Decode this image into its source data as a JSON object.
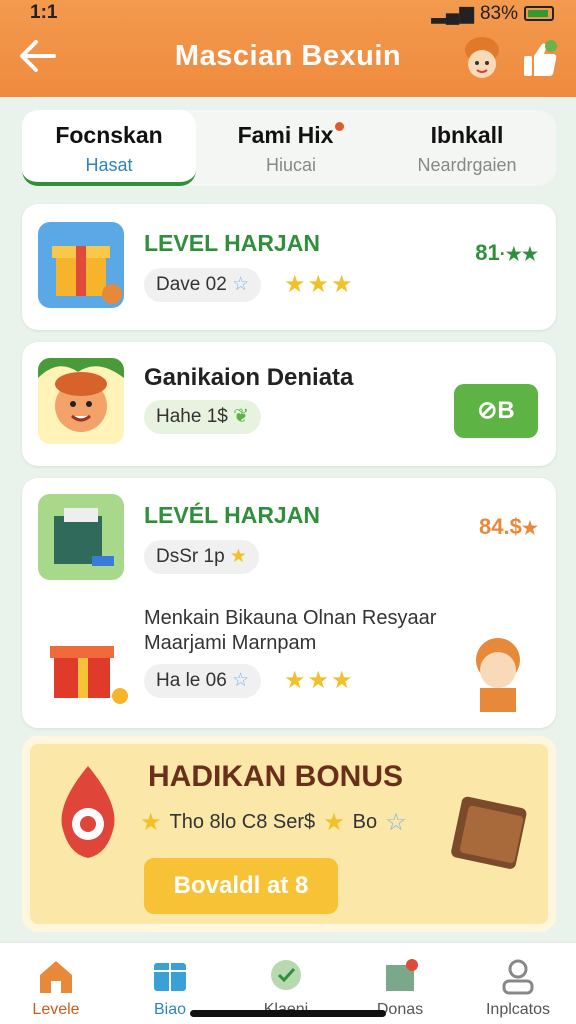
{
  "status_bar": {
    "time": "1:1",
    "battery": "83%"
  },
  "header": {
    "title": "Mascian Bexuin"
  },
  "tabs": [
    {
      "label": "Focnskan",
      "sub": "Hasat"
    },
    {
      "label": "Fami Hix",
      "sub": "Hiucai"
    },
    {
      "label": "Ibnkall",
      "sub": "Neardrgaien"
    }
  ],
  "cards": [
    {
      "title": "LEVEL HARJAN",
      "pill": "Dave 02",
      "score": "81",
      "score_color": "#2f8f3a"
    },
    {
      "title": "Ganikaion Deniata",
      "pill": "Hahe 1$",
      "badge": "B"
    },
    {
      "title": "LEVÉL HARJAN",
      "pill": "DsSr 1p",
      "score": "84.$",
      "score_color": "#e8893a",
      "text": "Menkain Bikauna Olnan Resyaar Maarjami Marnpam",
      "pill2": "Ha le 06"
    }
  ],
  "bonus": {
    "title": "HADIKAN BONUS",
    "line_a": "Tho 8lo C8 Ser$",
    "line_b": "Bo",
    "button": "Bovaldl at 8"
  },
  "nav": [
    {
      "label": "Levele"
    },
    {
      "label": "Biao"
    },
    {
      "label": "Klaeni"
    },
    {
      "label": "Donas"
    },
    {
      "label": "Inplcatos"
    }
  ],
  "colors": {
    "header": "#ef8a3e",
    "accent_green": "#2f8f3a",
    "bonus_bg": "#fbe7a8",
    "button_yellow": "#f7c236"
  },
  "icons": [
    "back-arrow-icon",
    "avatar-icon",
    "thumbs-up-icon",
    "gift-icon",
    "star-icon",
    "check-icon",
    "wallet-icon",
    "home-icon",
    "box-icon",
    "badge-icon",
    "map-icon",
    "profile-icon"
  ]
}
